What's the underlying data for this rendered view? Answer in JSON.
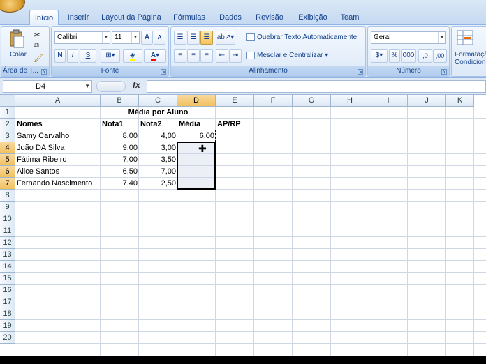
{
  "ribbon_tabs": [
    "Início",
    "Inserir",
    "Layout da Página",
    "Fórmulas",
    "Dados",
    "Revisão",
    "Exibição",
    "Team"
  ],
  "clipboard": {
    "paste_label": "Colar",
    "group_label": "Área de T..."
  },
  "font": {
    "name": "Calibri",
    "size": "11",
    "group_label": "Fonte",
    "bold": "N",
    "italic": "I",
    "underline": "S",
    "grow": "A",
    "shrink": "A"
  },
  "alignment": {
    "wrap_label": "Quebrar Texto Automaticamente",
    "merge_label": "Mesclar e Centralizar",
    "group_label": "Alinhamento"
  },
  "number": {
    "format": "Geral",
    "percent": "%",
    "thousands": "000",
    "inc_dec": ",0",
    "dec_dec": ",00",
    "group_label": "Número"
  },
  "styles": {
    "cond_format_line1": "Formatação",
    "cond_format_line2": "Condicional"
  },
  "formula_bar": {
    "name_box": "D4",
    "fx": "fx",
    "content": ""
  },
  "columns": [
    "A",
    "B",
    "C",
    "D",
    "E",
    "F",
    "G",
    "H",
    "I",
    "J",
    "K"
  ],
  "rows": [
    "1",
    "2",
    "3",
    "4",
    "5",
    "6",
    "7",
    "8",
    "9",
    "10",
    "11",
    "12",
    "13",
    "14",
    "15",
    "16",
    "17",
    "18",
    "19",
    "20"
  ],
  "sheet": {
    "title": "Média por Aluno",
    "headers": {
      "nomes": "Nomes",
      "nota1": "Nota1",
      "nota2": "Nota2",
      "media": "Média",
      "aprp": "AP/RP"
    },
    "students": [
      {
        "name": "Samy Carvalho",
        "nota1": "8,00",
        "nota2": "4,00",
        "media": "6,00"
      },
      {
        "name": "João DA Silva",
        "nota1": "9,00",
        "nota2": "3,00",
        "media": ""
      },
      {
        "name": "Fátima Ribeiro",
        "nota1": "7,00",
        "nota2": "3,50",
        "media": ""
      },
      {
        "name": "Alice Santos",
        "nota1": "6,50",
        "nota2": "7,00",
        "media": ""
      },
      {
        "name": "Fernando Nascimento",
        "nota1": "7,40",
        "nota2": "2,50",
        "media": ""
      }
    ]
  },
  "selection": {
    "active_cell": "D4",
    "range": "D4:D7",
    "copied_cell": "D3"
  },
  "colors": {
    "selection_header": "#f1c15f",
    "ribbon": "#d6e5f7",
    "gridline": "#d0d7e5"
  }
}
